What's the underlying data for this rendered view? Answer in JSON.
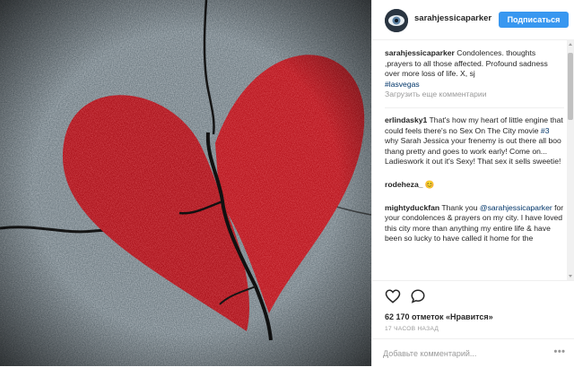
{
  "post": {
    "username": "sarahjessicaparker",
    "follow_label": "Подписаться"
  },
  "caption": {
    "username": "sarahjessicaparker",
    "text": "Condolences. thoughts ,prayers to all those affected. Profound sadness over more loss of life. X, sj",
    "hashtag": "#lasvegas"
  },
  "load_more_label": "Загрузить еще комментарии",
  "comments": [
    {
      "username": "erlindasky1",
      "text_before": "That's how my heart of little engine that could feels there's no Sex On The City movie",
      "tag": "#3",
      "text_after": "why Sarah Jessica your frenemy is out there all boo thang pretty and goes to work early! Come on... Ladieswork it out it's Sexy! That sex it sells sweetie!"
    },
    {
      "username": "rodeheza_",
      "text": "😊"
    },
    {
      "username": "mightyduckfan",
      "text_before": "Thank you",
      "mention": "@sarahjessicaparker",
      "text_after": "for your condolences & prayers on my city. I have loved this city more than anything my entire life & have been so lucky to have called it home for the"
    }
  ],
  "icons": {
    "like": "heart-outline-icon",
    "comment": "comment-bubble-icon",
    "more": "more-options-icon"
  },
  "likes_text": "62 170 отметок «Нравится»",
  "timestamp": "17 ЧАСОВ НАЗАД",
  "comment_input": {
    "placeholder": "Добавьте комментарий...",
    "value": ""
  },
  "more_label": "•••",
  "colors": {
    "accent": "#3897f0",
    "link": "#003569",
    "muted": "#999999",
    "heart_red": "#c8141c"
  }
}
